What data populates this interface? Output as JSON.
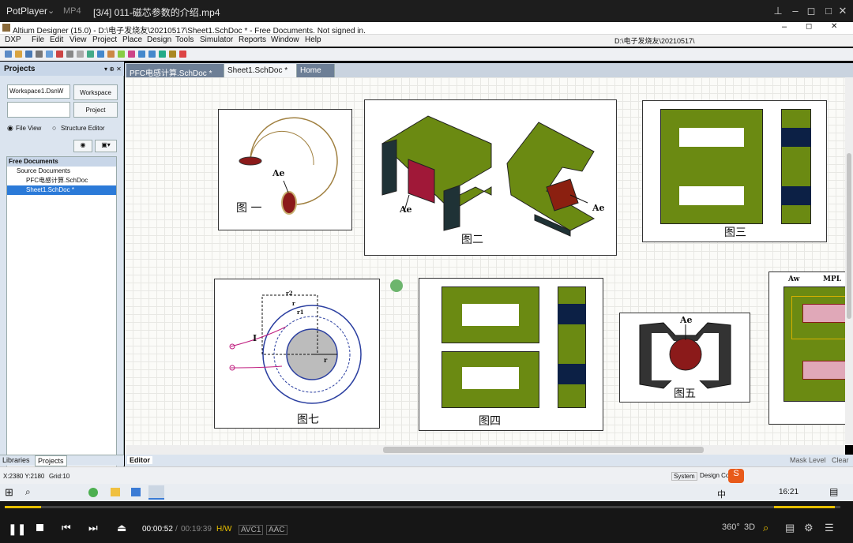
{
  "player": {
    "brand": "PotPlayer",
    "format": "MP4",
    "file_title": "[3/4] 011-磁芯参数的介绍.mp4",
    "current_time": "00:00:52",
    "separator": "/",
    "total_time": "00:19:39",
    "hw": "H/W",
    "vcodec": "AVC1",
    "acodec": "AAC",
    "progress": 0.044,
    "volume": 0.92
  },
  "app": {
    "window_title": "Altium Designer (15.0) - D:\\电子发烧友\\20210517\\Sheet1.SchDoc * - Free Documents. Not signed in."
  },
  "menu": [
    "DXP",
    "File",
    "Edit",
    "View",
    "Project",
    "Place",
    "Design",
    "Tools",
    "Simulator",
    "Reports",
    "Window",
    "Help"
  ],
  "path_field": "D:\\电子发烧友\\20210517\\",
  "projects": {
    "title": "Projects",
    "workspace_select": "Workspace1.DsnW",
    "workspace_btn": "Workspace",
    "project_btn": "Project",
    "file_view": "File View",
    "structure_editor": "Structure Editor",
    "tree": [
      {
        "label": "Free Documents",
        "level": 0
      },
      {
        "label": "Source Documents",
        "level": 1
      },
      {
        "label": "PFC电感计算.SchDoc",
        "level": 2
      },
      {
        "label": "Sheet1.SchDoc *",
        "level": 2,
        "selected": true
      }
    ],
    "tabs": [
      "Libraries",
      "Projects"
    ]
  },
  "doc_tabs": [
    {
      "label": "PFC电感计算.SchDoc *"
    },
    {
      "label": "Sheet1.SchDoc *",
      "active": true
    },
    {
      "label": "Home"
    }
  ],
  "figures": {
    "fig1": "图 一",
    "fig2": "图二",
    "fig3": "图三",
    "fig4": "图四",
    "fig5": "图五",
    "fig7": "图七",
    "ae": "Ae",
    "aw": "Aw",
    "mpl": "MPL",
    "i_label": "I",
    "r_label": "r",
    "r1": "r1",
    "r2": "r2"
  },
  "editor_tab": "Editor",
  "right_bottom": [
    "Mask Level",
    "Clear"
  ],
  "status": {
    "coords": "X:2380 Y:2180",
    "grid": "Grid:10",
    "system": "System",
    "design_compiler": "Design Co"
  },
  "taskbar": {
    "time": "16:21",
    "ime": "中"
  }
}
